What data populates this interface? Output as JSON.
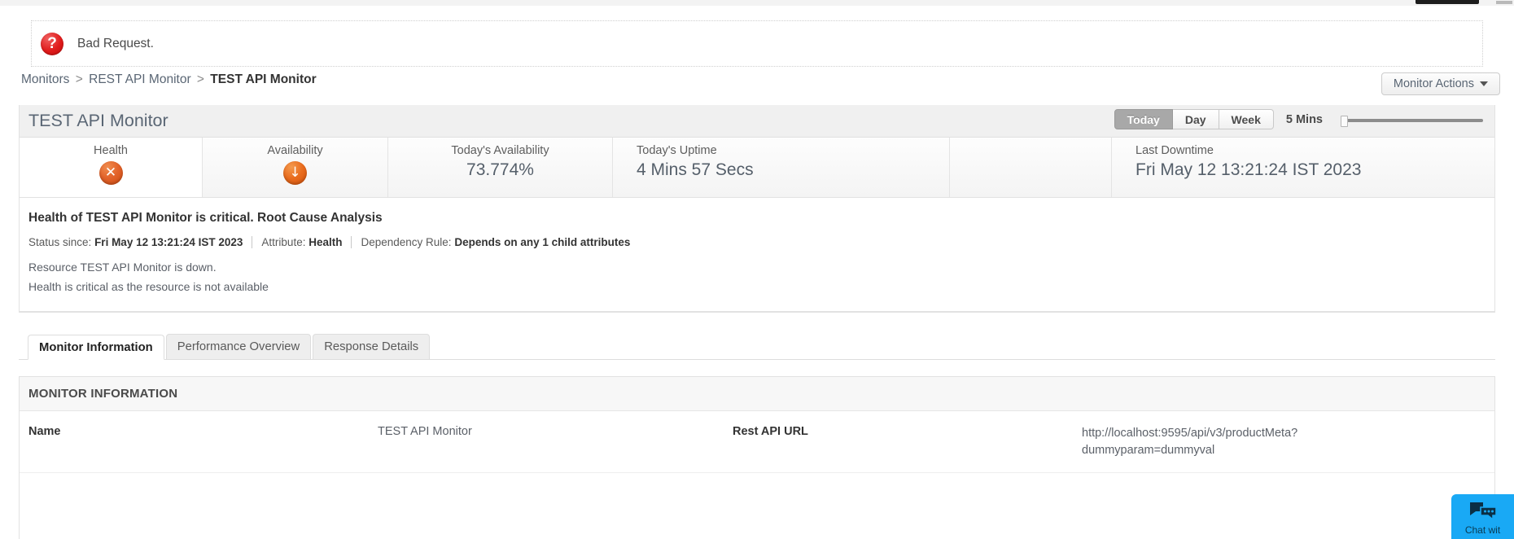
{
  "alert": {
    "icon": "question-mark-icon",
    "message": "Bad Request."
  },
  "breadcrumb": {
    "items": [
      {
        "label": "Monitors",
        "current": false
      },
      {
        "label": "REST API Monitor",
        "current": false
      },
      {
        "label": "TEST API Monitor",
        "current": true
      }
    ],
    "separator": ">"
  },
  "header": {
    "monitor_actions_label": "Monitor Actions",
    "monitor_actions_icon": "chevron-down-icon"
  },
  "card": {
    "title": "TEST API Monitor",
    "range_buttons": [
      {
        "label": "Today",
        "active": true
      },
      {
        "label": "Day",
        "active": false
      },
      {
        "label": "Week",
        "active": false
      }
    ],
    "poll_interval": "5 Mins"
  },
  "stats": [
    {
      "label": "Health",
      "kind": "icon",
      "icon": "critical-x-icon",
      "glyph": "✕",
      "value": ""
    },
    {
      "label": "Availability",
      "kind": "icon",
      "icon": "down-arrow-icon",
      "glyph": "↓",
      "value": ""
    },
    {
      "label": "Today's Availability",
      "kind": "text",
      "value": "73.774%"
    },
    {
      "label": "Today's Uptime",
      "kind": "text",
      "value": "4 Mins 57 Secs"
    },
    {
      "label": "Last Downtime",
      "kind": "text",
      "value": "Fri May 12 13:21:24 IST 2023"
    }
  ],
  "rca": {
    "title": "Health of TEST API Monitor is critical. Root Cause Analysis",
    "meta": {
      "status_since_label": "Status since:",
      "status_since_value": "Fri May 12 13:21:24 IST 2023",
      "attribute_label": "Attribute:",
      "attribute_value": "Health",
      "dependency_label": "Dependency Rule:",
      "dependency_value": "Depends on any 1 child attributes"
    },
    "lines": [
      "Resource TEST API Monitor is down.",
      "Health is critical as the resource is not available"
    ]
  },
  "tabs": [
    {
      "label": "Monitor Information",
      "active": true
    },
    {
      "label": "Performance Overview",
      "active": false
    },
    {
      "label": "Response Details",
      "active": false
    }
  ],
  "monitor_information": {
    "section_title": "MONITOR INFORMATION",
    "rows": [
      {
        "key1": "Name",
        "val1": "TEST API Monitor",
        "key2": "Rest API URL",
        "val2": "http://localhost:9595/api/v3/productMeta?dummyparam=dummyval"
      }
    ]
  },
  "chat": {
    "icon": "chat-bubbles-icon",
    "label": "Chat wit"
  },
  "colors": {
    "accent_orange": "#e2622a",
    "error_red": "#e01b1b",
    "chat_blue": "#19a9f5",
    "text_muted": "#5b6068"
  }
}
